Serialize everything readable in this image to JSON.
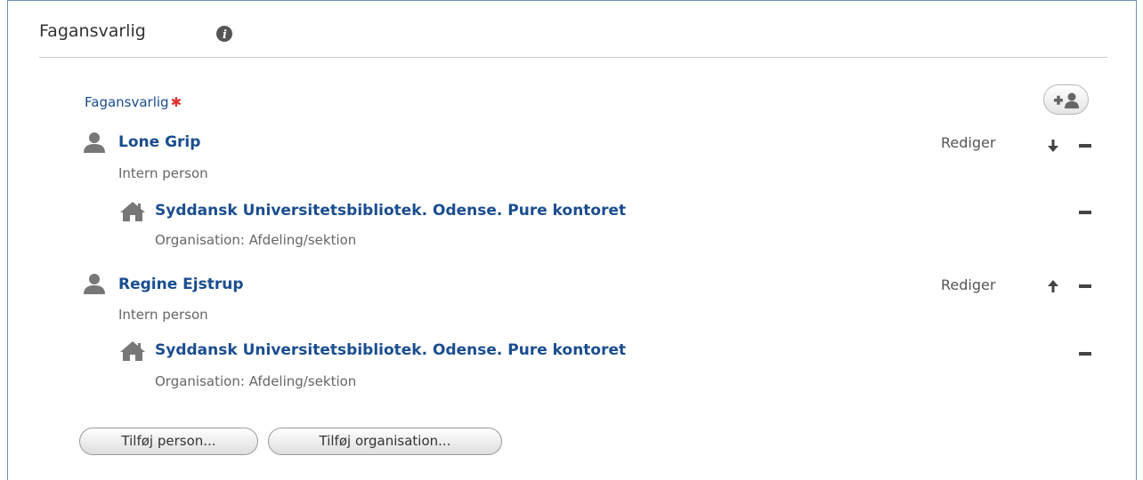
{
  "section": {
    "title": "Fagansvarlig",
    "info_icon": "info-icon"
  },
  "field": {
    "label": "Fagansvarlig",
    "required_mark": "✱",
    "add_person_icon": "add-person-icon"
  },
  "persons": [
    {
      "name": "Lone Grip",
      "type": "Intern person",
      "edit_label": "Rediger",
      "move_icon": "arrow-down-icon",
      "organisation": {
        "name": "Syddansk Universitetsbibliotek. Odense. Pure kontoret",
        "type": "Organisation: Afdeling/sektion"
      }
    },
    {
      "name": "Regine Ejstrup",
      "type": "Intern person",
      "edit_label": "Rediger",
      "move_icon": "arrow-up-icon",
      "organisation": {
        "name": "Syddansk Universitetsbibliotek. Odense. Pure kontoret",
        "type": "Organisation: Afdeling/sektion"
      }
    }
  ],
  "buttons": {
    "add_person": "Tilføj person...",
    "add_organisation": "Tilføj organisation..."
  },
  "colors": {
    "link": "#1a4d8f",
    "required": "#dd3333",
    "border": "#6f8fbf"
  }
}
